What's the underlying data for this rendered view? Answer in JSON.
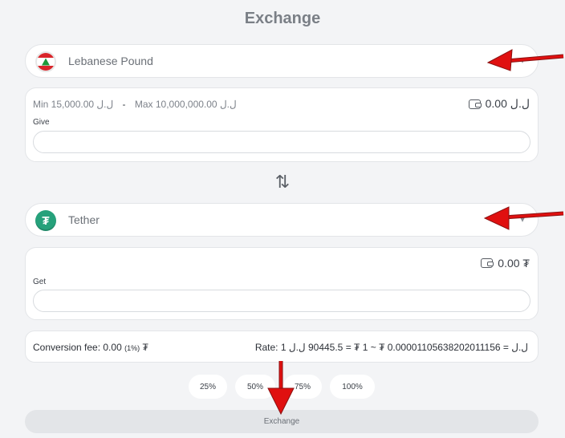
{
  "page": {
    "title": "Exchange"
  },
  "give": {
    "currency": {
      "name": "Lebanese Pound",
      "icon": "lebanon-flag-icon"
    },
    "min_label": "Min 15,000.00 ل.ل",
    "separator": "-",
    "max_label": "Max 10,000,000.00 ل.ل",
    "balance": "0.00 ل.ل",
    "label": "Give",
    "value": ""
  },
  "swap_icon": "⇅",
  "get": {
    "currency": {
      "name": "Tether",
      "icon": "tether-icon",
      "symbol": "₮"
    },
    "balance": "0.00 ₮",
    "label": "Get",
    "value": ""
  },
  "info": {
    "fee_label": "Conversion fee: 0.00",
    "fee_pct": "(1%)",
    "fee_unit": "₮",
    "rate": "Rate: 1 ل.ل = 0.00001105638202011156 ₮ ~ 1 ₮ = 90445.5 ل.ل"
  },
  "percent_buttons": [
    "25%",
    "50%",
    "75%",
    "100%"
  ],
  "exchange_button": "Exchange",
  "colors": {
    "tether": "#26a17b",
    "flag_red": "#d9252a",
    "flag_cedar": "#1e9a3a",
    "arrow": "#e01010"
  }
}
